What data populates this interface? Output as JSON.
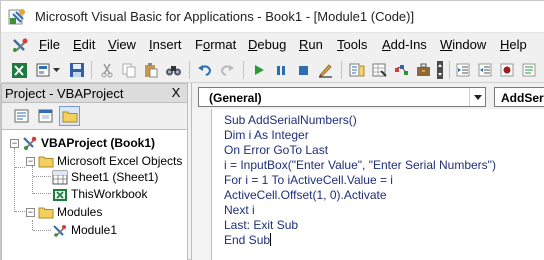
{
  "window": {
    "title": "Microsoft Visual Basic for Applications - Book1 - [Module1 (Code)]"
  },
  "menu": [
    {
      "pre": "",
      "ul": "F",
      "post": "ile"
    },
    {
      "pre": "",
      "ul": "E",
      "post": "dit"
    },
    {
      "pre": "",
      "ul": "V",
      "post": "iew"
    },
    {
      "pre": "",
      "ul": "I",
      "post": "nsert"
    },
    {
      "pre": "F",
      "ul": "o",
      "post": "rmat"
    },
    {
      "pre": "",
      "ul": "D",
      "post": "ebug"
    },
    {
      "pre": "",
      "ul": "R",
      "post": "un"
    },
    {
      "pre": "",
      "ul": "T",
      "post": "ools"
    },
    {
      "pre": "",
      "ul": "A",
      "post": "dd-Ins"
    },
    {
      "pre": "",
      "ul": "W",
      "post": "indow"
    },
    {
      "pre": "",
      "ul": "H",
      "post": "elp"
    }
  ],
  "project": {
    "title": "Project - VBAProject",
    "close": "X",
    "tree": {
      "root": "VBAProject (Book1)",
      "excel_objects": "Microsoft Excel Objects",
      "sheet1": "Sheet1 (Sheet1)",
      "workbook": "ThisWorkbook",
      "modules": "Modules",
      "module1": "Module1"
    }
  },
  "code": {
    "object_combo": "(General)",
    "proc_combo": "AddSerialNumbers",
    "lines": [
      "Sub AddSerialNumbers()",
      "Dim i As Integer",
      "On Error GoTo Last",
      "i = InputBox(\"Enter Value\", \"Enter Serial Numbers\")",
      "For i = 1 To iActiveCell.Value = i",
      "ActiveCell.Offset(1, 0).Activate",
      "Next i",
      "Last: Exit Sub",
      "End Sub"
    ]
  },
  "colors": {
    "code_text": "#1f2f7a",
    "accent": "#2e6db4"
  }
}
